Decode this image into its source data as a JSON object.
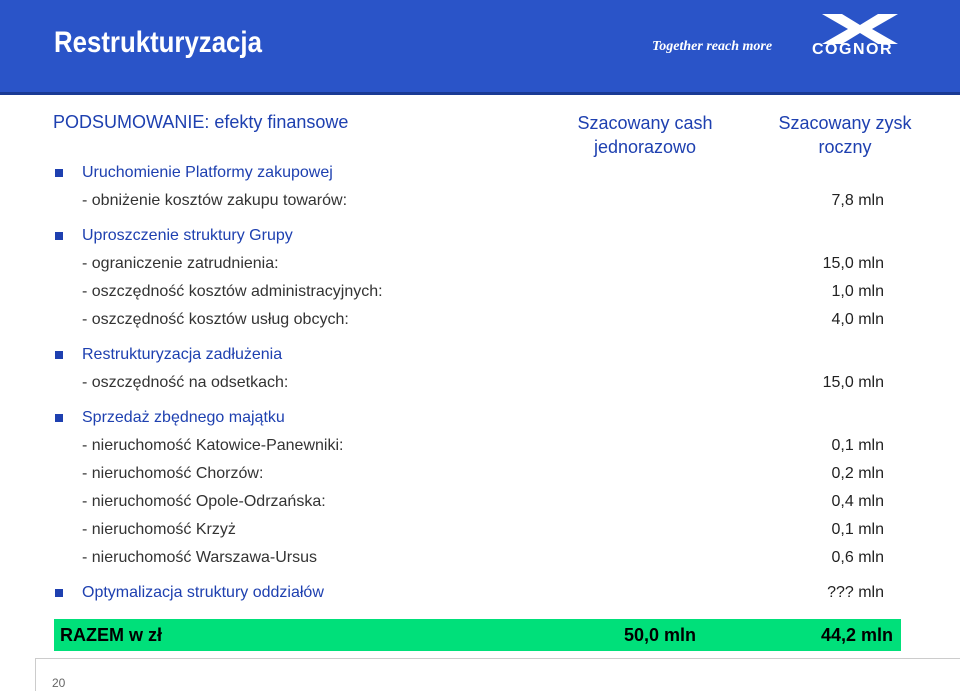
{
  "header": {
    "title": "Restrukturyzacja",
    "slogan": "Together reach more",
    "logo_text": "COGNOR",
    "logo_icon": "cognor-x-logo-icon",
    "bg_color": "#2a54c8"
  },
  "summary": {
    "heading": "PODSUMOWANIE: efekty finansowe",
    "col_cash": [
      "Szacowany cash",
      "jednorazowo"
    ],
    "col_zysk": [
      "Szacowany zysk",
      "roczny"
    ]
  },
  "rows": [
    {
      "type": "section",
      "label": "Uruchomienie Platformy zakupowej",
      "value": ""
    },
    {
      "type": "item",
      "label": "- obniżenie kosztów zakupu towarów:",
      "value": "7,8 mln"
    },
    {
      "type": "section",
      "label": "Uproszczenie struktury Grupy",
      "value": ""
    },
    {
      "type": "item",
      "label": "- ograniczenie zatrudnienia:",
      "value": "15,0 mln"
    },
    {
      "type": "item",
      "label": "- oszczędność kosztów administracyjnych:",
      "value": "1,0 mln"
    },
    {
      "type": "item",
      "label": "- oszczędność kosztów usług obcych:",
      "value": "4,0 mln"
    },
    {
      "type": "section",
      "label": "Restrukturyzacja zadłużenia",
      "value": ""
    },
    {
      "type": "item",
      "label": "- oszczędność na odsetkach:",
      "value": "15,0 mln"
    },
    {
      "type": "section",
      "label": "Sprzedaż zbędnego majątku",
      "value": ""
    },
    {
      "type": "item",
      "label": "- nieruchomość Katowice-Panewniki:",
      "value": "0,1 mln"
    },
    {
      "type": "item",
      "label": "- nieruchomość Chorzów:",
      "value": "0,2 mln"
    },
    {
      "type": "item",
      "label": "- nieruchomość Opole-Odrzańska:",
      "value": "0,4 mln"
    },
    {
      "type": "item",
      "label": "- nieruchomość Krzyż",
      "value": "0,1 mln"
    },
    {
      "type": "item",
      "label": "- nieruchomość Warszawa-Ursus",
      "value": "0,6 mln"
    },
    {
      "type": "section",
      "label": "Optymalizacja struktury oddziałów",
      "value": "??? mln"
    }
  ],
  "total": {
    "label": "RAZEM w zł",
    "cash": "50,0 mln",
    "zysk": "44,2 mln",
    "bg_color": "#00e07a"
  },
  "page_number": "20"
}
